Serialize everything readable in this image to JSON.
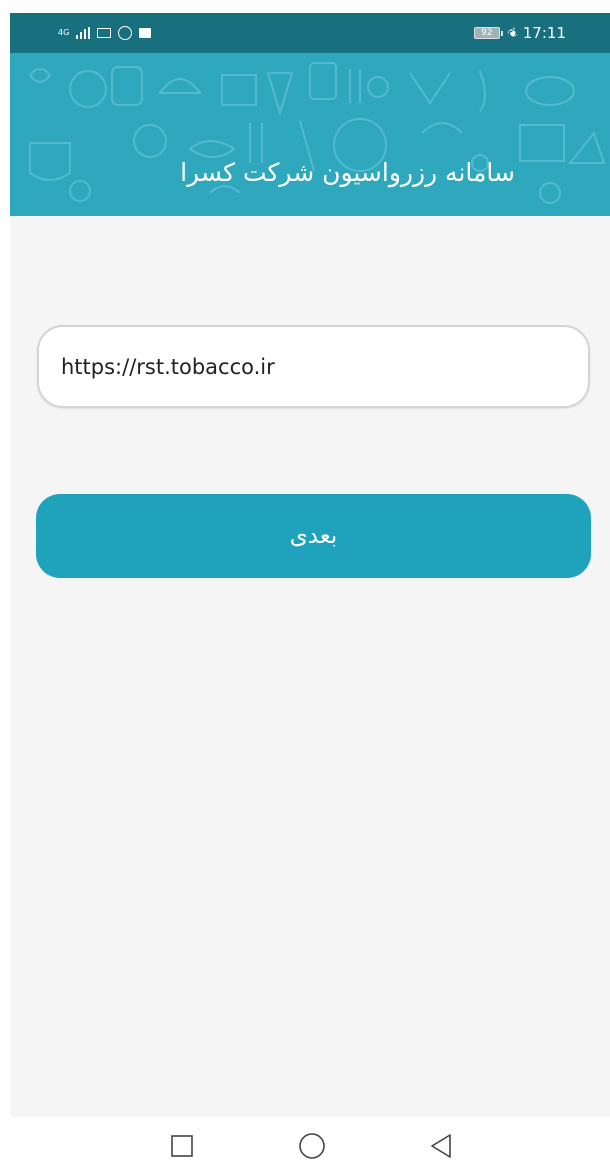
{
  "status_bar": {
    "network_label": "4G",
    "battery_level": "92",
    "time": "17:11"
  },
  "header": {
    "title": "سامانه رزرواسیون شرکت کسرا",
    "background_color": "#2fa8bd"
  },
  "form": {
    "url_value": "https://rst.tobacco.ir",
    "next_label": "بعدی",
    "button_color": "#1fa3bc"
  },
  "nav_bar": {
    "icons": [
      "recent-apps-icon",
      "home-icon",
      "back-icon"
    ]
  }
}
